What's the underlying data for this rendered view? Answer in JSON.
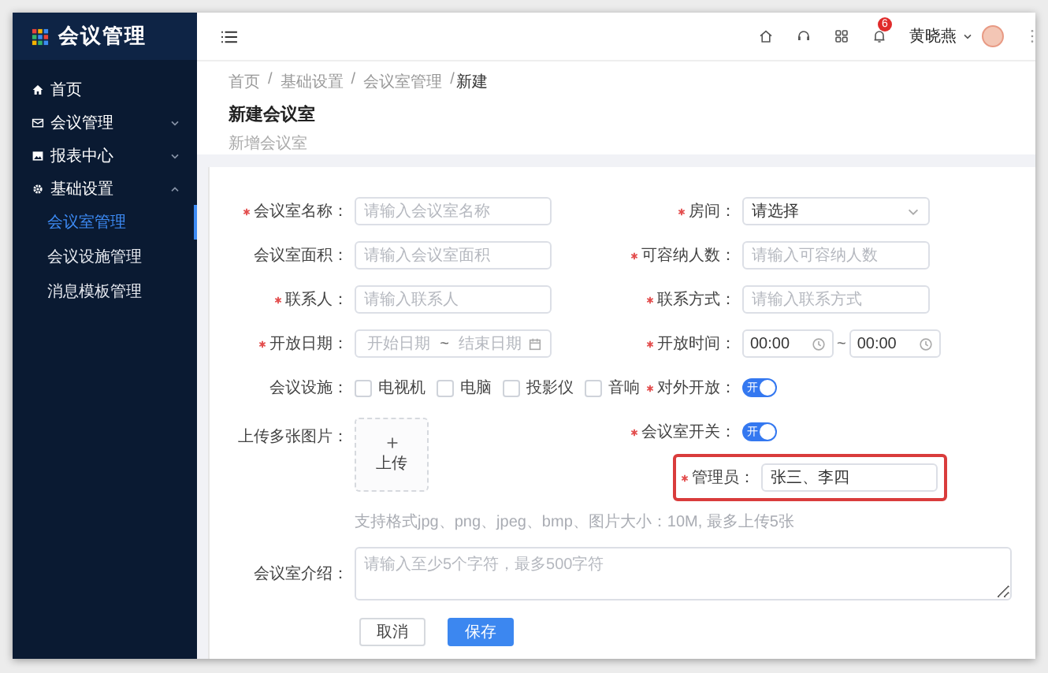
{
  "app": {
    "title": "会议管理"
  },
  "sidebar": {
    "items": [
      {
        "label": "首页",
        "kind": "link"
      },
      {
        "label": "会议管理",
        "kind": "group",
        "expanded": false
      },
      {
        "label": "报表中心",
        "kind": "group",
        "expanded": false
      },
      {
        "label": "基础设置",
        "kind": "group",
        "expanded": true,
        "children": [
          {
            "label": "会议室管理",
            "selected": true
          },
          {
            "label": "会议设施管理",
            "selected": false
          },
          {
            "label": "消息模板管理",
            "selected": false
          }
        ]
      }
    ]
  },
  "header": {
    "notification_count": "6",
    "user_name": "黄晓燕"
  },
  "breadcrumb": {
    "items": [
      "首页",
      "基础设置",
      "会议室管理",
      "新建"
    ],
    "separator": "/"
  },
  "page": {
    "title": "新建会议室",
    "subtitle": "新增会议室"
  },
  "form": {
    "left": [
      {
        "kind": "text",
        "label": "会议室名称：",
        "required": true,
        "placeholder": "请输入会议室名称"
      },
      {
        "kind": "text",
        "label": "会议室面积：",
        "required": false,
        "placeholder": "请输入会议室面积"
      },
      {
        "kind": "text",
        "label": "联系人：",
        "required": true,
        "placeholder": "请输入联系人"
      },
      {
        "kind": "daterange",
        "label": "开放日期：",
        "required": true,
        "start_placeholder": "开始日期",
        "end_placeholder": "结束日期",
        "separator": "~"
      },
      {
        "kind": "checkboxes",
        "label": "会议设施：",
        "required": false,
        "options": [
          {
            "label": "电视机",
            "checked": false
          },
          {
            "label": "电脑",
            "checked": false
          },
          {
            "label": "投影仪",
            "checked": false
          },
          {
            "label": "音响",
            "checked": false
          }
        ]
      },
      {
        "kind": "upload",
        "label": "上传多张图片：",
        "required": false,
        "button_text": "上传",
        "hint": "支持格式jpg、png、jpeg、bmp、图片大小：10M, 最多上传5张"
      }
    ],
    "right": [
      {
        "kind": "select",
        "label": "房间：",
        "required": true,
        "placeholder": "请选择",
        "highlighted": false
      },
      {
        "kind": "text",
        "label": "可容纳人数：",
        "required": true,
        "placeholder": "请输入可容纳人数",
        "highlighted": false
      },
      {
        "kind": "text",
        "label": "联系方式：",
        "required": true,
        "placeholder": "请输入联系方式",
        "highlighted": false
      },
      {
        "kind": "timerange",
        "label": "开放时间：",
        "required": true,
        "start": "00:00",
        "end": "00:00",
        "separator": "~",
        "highlighted": false
      },
      {
        "kind": "switch",
        "label": "对外开放：",
        "required": true,
        "on": true,
        "text": "开",
        "highlighted": false
      },
      {
        "kind": "switch",
        "label": "会议室开关：",
        "required": true,
        "on": true,
        "text": "开",
        "highlighted": false
      },
      {
        "kind": "text",
        "label": "管理员：",
        "required": true,
        "value": "张三、李四",
        "highlighted": true
      }
    ],
    "description": {
      "label": "会议室介绍：",
      "required": false,
      "placeholder": "请输入至少5个字符，最多500字符"
    },
    "buttons": [
      {
        "label": "取消",
        "kind": "default"
      },
      {
        "label": "保存",
        "kind": "primary"
      }
    ]
  }
}
